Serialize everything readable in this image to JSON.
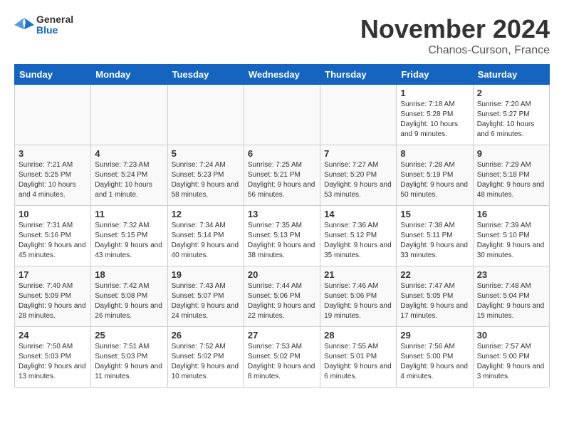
{
  "header": {
    "logo_line1": "General",
    "logo_line2": "Blue",
    "month_title": "November 2024",
    "location": "Chanos-Curson, France"
  },
  "weekdays": [
    "Sunday",
    "Monday",
    "Tuesday",
    "Wednesday",
    "Thursday",
    "Friday",
    "Saturday"
  ],
  "weeks": [
    [
      {
        "day": "",
        "info": ""
      },
      {
        "day": "",
        "info": ""
      },
      {
        "day": "",
        "info": ""
      },
      {
        "day": "",
        "info": ""
      },
      {
        "day": "",
        "info": ""
      },
      {
        "day": "1",
        "info": "Sunrise: 7:18 AM\nSunset: 5:28 PM\nDaylight: 10 hours and 9 minutes."
      },
      {
        "day": "2",
        "info": "Sunrise: 7:20 AM\nSunset: 5:27 PM\nDaylight: 10 hours and 6 minutes."
      }
    ],
    [
      {
        "day": "3",
        "info": "Sunrise: 7:21 AM\nSunset: 5:25 PM\nDaylight: 10 hours and 4 minutes."
      },
      {
        "day": "4",
        "info": "Sunrise: 7:23 AM\nSunset: 5:24 PM\nDaylight: 10 hours and 1 minute."
      },
      {
        "day": "5",
        "info": "Sunrise: 7:24 AM\nSunset: 5:23 PM\nDaylight: 9 hours and 58 minutes."
      },
      {
        "day": "6",
        "info": "Sunrise: 7:25 AM\nSunset: 5:21 PM\nDaylight: 9 hours and 56 minutes."
      },
      {
        "day": "7",
        "info": "Sunrise: 7:27 AM\nSunset: 5:20 PM\nDaylight: 9 hours and 53 minutes."
      },
      {
        "day": "8",
        "info": "Sunrise: 7:28 AM\nSunset: 5:19 PM\nDaylight: 9 hours and 50 minutes."
      },
      {
        "day": "9",
        "info": "Sunrise: 7:29 AM\nSunset: 5:18 PM\nDaylight: 9 hours and 48 minutes."
      }
    ],
    [
      {
        "day": "10",
        "info": "Sunrise: 7:31 AM\nSunset: 5:16 PM\nDaylight: 9 hours and 45 minutes."
      },
      {
        "day": "11",
        "info": "Sunrise: 7:32 AM\nSunset: 5:15 PM\nDaylight: 9 hours and 43 minutes."
      },
      {
        "day": "12",
        "info": "Sunrise: 7:34 AM\nSunset: 5:14 PM\nDaylight: 9 hours and 40 minutes."
      },
      {
        "day": "13",
        "info": "Sunrise: 7:35 AM\nSunset: 5:13 PM\nDaylight: 9 hours and 38 minutes."
      },
      {
        "day": "14",
        "info": "Sunrise: 7:36 AM\nSunset: 5:12 PM\nDaylight: 9 hours and 35 minutes."
      },
      {
        "day": "15",
        "info": "Sunrise: 7:38 AM\nSunset: 5:11 PM\nDaylight: 9 hours and 33 minutes."
      },
      {
        "day": "16",
        "info": "Sunrise: 7:39 AM\nSunset: 5:10 PM\nDaylight: 9 hours and 30 minutes."
      }
    ],
    [
      {
        "day": "17",
        "info": "Sunrise: 7:40 AM\nSunset: 5:09 PM\nDaylight: 9 hours and 28 minutes."
      },
      {
        "day": "18",
        "info": "Sunrise: 7:42 AM\nSunset: 5:08 PM\nDaylight: 9 hours and 26 minutes."
      },
      {
        "day": "19",
        "info": "Sunrise: 7:43 AM\nSunset: 5:07 PM\nDaylight: 9 hours and 24 minutes."
      },
      {
        "day": "20",
        "info": "Sunrise: 7:44 AM\nSunset: 5:06 PM\nDaylight: 9 hours and 22 minutes."
      },
      {
        "day": "21",
        "info": "Sunrise: 7:46 AM\nSunset: 5:06 PM\nDaylight: 9 hours and 19 minutes."
      },
      {
        "day": "22",
        "info": "Sunrise: 7:47 AM\nSunset: 5:05 PM\nDaylight: 9 hours and 17 minutes."
      },
      {
        "day": "23",
        "info": "Sunrise: 7:48 AM\nSunset: 5:04 PM\nDaylight: 9 hours and 15 minutes."
      }
    ],
    [
      {
        "day": "24",
        "info": "Sunrise: 7:50 AM\nSunset: 5:03 PM\nDaylight: 9 hours and 13 minutes."
      },
      {
        "day": "25",
        "info": "Sunrise: 7:51 AM\nSunset: 5:03 PM\nDaylight: 9 hours and 11 minutes."
      },
      {
        "day": "26",
        "info": "Sunrise: 7:52 AM\nSunset: 5:02 PM\nDaylight: 9 hours and 10 minutes."
      },
      {
        "day": "27",
        "info": "Sunrise: 7:53 AM\nSunset: 5:02 PM\nDaylight: 9 hours and 8 minutes."
      },
      {
        "day": "28",
        "info": "Sunrise: 7:55 AM\nSunset: 5:01 PM\nDaylight: 9 hours and 6 minutes."
      },
      {
        "day": "29",
        "info": "Sunrise: 7:56 AM\nSunset: 5:00 PM\nDaylight: 9 hours and 4 minutes."
      },
      {
        "day": "30",
        "info": "Sunrise: 7:57 AM\nSunset: 5:00 PM\nDaylight: 9 hours and 3 minutes."
      }
    ]
  ]
}
